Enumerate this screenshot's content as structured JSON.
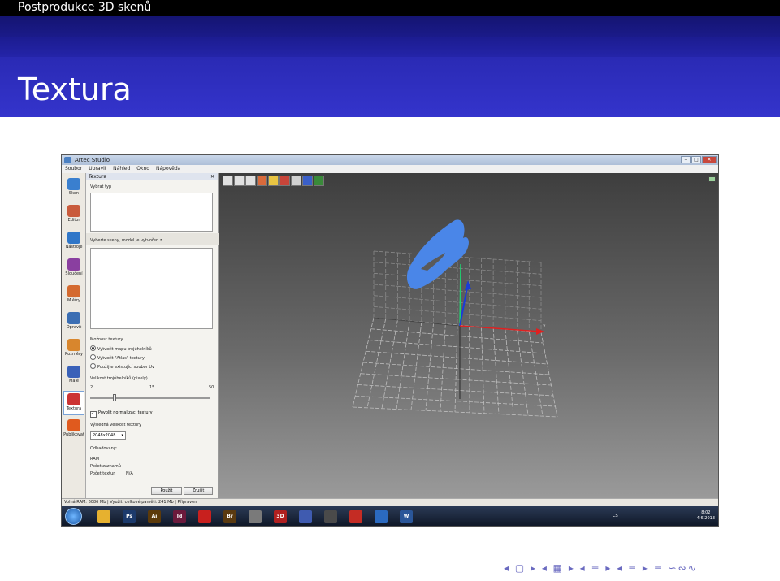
{
  "slide": {
    "section_title": "Postprodukce 3D skenů",
    "frame_title": "Textura",
    "nav_symbols": "◂ ▢ ▸ ◂ ▦ ▸ ◂ ≡ ▸ ◂ ≡ ▸   ≡   ∽∾∿"
  },
  "app": {
    "window_title": "Artec Studio",
    "menu": [
      "Soubor",
      "Upravit",
      "Náhled",
      "Okno",
      "Nápověda"
    ],
    "tools": [
      {
        "label": "Sken",
        "color": "#3a7fcf"
      },
      {
        "label": "Editor",
        "color": "#c95b3c"
      },
      {
        "label": "Nástroje",
        "color": "#2f76c8"
      },
      {
        "label": "Sloučení",
        "color": "#8a3fa0"
      },
      {
        "label": "M ěřry",
        "color": "#d46a2f"
      },
      {
        "label": "Opravit",
        "color": "#3b6eb3"
      },
      {
        "label": "Rozměry",
        "color": "#d8862d"
      },
      {
        "label": "Malé",
        "color": "#3a61b8"
      },
      {
        "label": "Textura",
        "color": "#cc3333"
      },
      {
        "label": "Publikovat",
        "color": "#e05a1e"
      }
    ],
    "panel": {
      "title": "Textura",
      "close": "✕",
      "choose_type": "Vybrat typ",
      "select_scans": "Vyberte skeny, model je vytvořen z",
      "texture_options": "Možnost textury",
      "radio_1": "Vytvořit mapu trojúhelníků",
      "radio_2": "Vytvořit \"Atlas\" textury",
      "radio_3": "Použijte existující soubor Uv",
      "triangle_size": "Velikost trojúhelníků (pixely)",
      "slider_min": "2",
      "slider_mid": "15",
      "slider_max": "50",
      "normalize": "Povolit normalizaci textury",
      "texture_size_label": "Výsledná velikost textury",
      "texture_size_value": "2048x2048",
      "estimated": "Odhadovaný:",
      "ram": "RAM",
      "snapshots": "Počet záznamů",
      "texture_count": "Počet textur",
      "texture_count_value": "N/A",
      "btn_apply": "Použít",
      "btn_cancel": "Zrušit"
    },
    "status": "Volná RAM: 6086 Mb  |  Využití celkové paměti: 241 Mb  |  Připraven",
    "taskbar": {
      "apps": [
        {
          "label": "",
          "color": "#e6b12f"
        },
        {
          "label": "Ps",
          "color": "#1c3a6c"
        },
        {
          "label": "Ai",
          "color": "#5c3a0a"
        },
        {
          "label": "Id",
          "color": "#6b1a3c"
        },
        {
          "label": "",
          "color": "#c8201e"
        },
        {
          "label": "Br",
          "color": "#5a3a10"
        },
        {
          "label": "",
          "color": "#7a7a7a"
        },
        {
          "label": "3D",
          "color": "#b02020"
        },
        {
          "label": "",
          "color": "#3f5bb0"
        },
        {
          "label": "",
          "color": "#4a4a4a"
        },
        {
          "label": "",
          "color": "#c42c24"
        },
        {
          "label": "",
          "color": "#2b6ac0"
        },
        {
          "label": "W",
          "color": "#2a5699"
        }
      ],
      "lang": "CS",
      "time": "8:02",
      "date": "4.6.2013"
    },
    "viewport": {
      "mesh_color": "#4a86e8",
      "axis_x_color": "#e02020",
      "axis_y_color": "#1fd06f",
      "axis_z_color": "#1a3cd8",
      "axis_x_label": "x"
    }
  }
}
